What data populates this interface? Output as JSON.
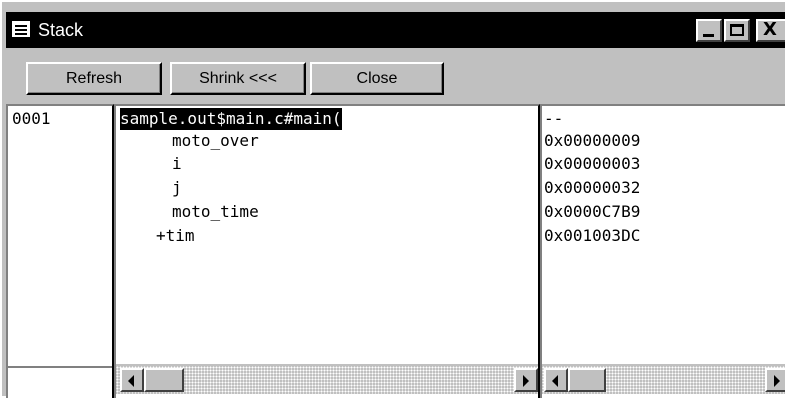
{
  "window": {
    "title": "Stack",
    "close_glyph": "X"
  },
  "toolbar": {
    "refresh_label": "Refresh",
    "shrink_label": "Shrink <<<",
    "close_label": "Close"
  },
  "stack": {
    "frames": [
      {
        "index": "0001",
        "function": "sample.out$main.c#main(",
        "value": "--"
      }
    ],
    "variables": [
      {
        "name": "moto_over",
        "value": "0x00000009"
      },
      {
        "name": "i",
        "value": "0x00000003"
      },
      {
        "name": "j",
        "value": "0x00000032"
      },
      {
        "name": "moto_time",
        "value": "0x0000C7B9"
      },
      {
        "name": "+tim",
        "value": "0x001003DC"
      }
    ]
  },
  "icons": {
    "system_menu": "window-menu-icon",
    "minimize": "minimize-icon",
    "maximize": "maximize-icon",
    "close": "close-icon",
    "scroll_left": "scroll-left-arrow-icon",
    "scroll_right": "scroll-right-arrow-icon"
  }
}
